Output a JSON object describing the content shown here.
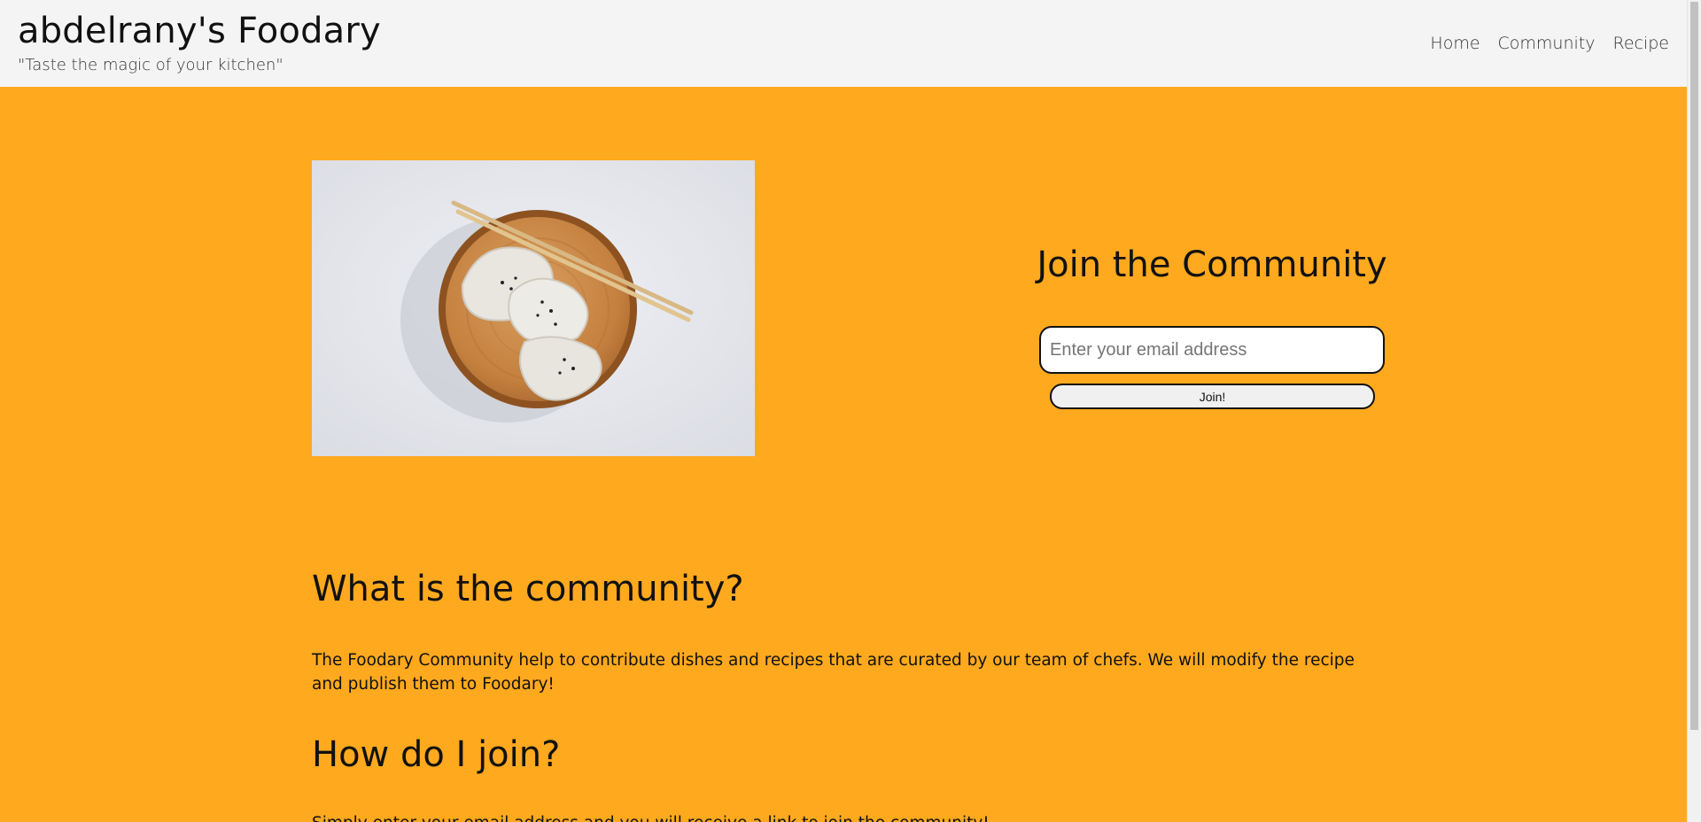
{
  "header": {
    "title": "abdelrany's Foodary",
    "tagline": "\"Taste the magic of your kitchen\"",
    "nav": [
      "Home",
      "Community",
      "Recipe"
    ]
  },
  "hero": {
    "image_icon": "dumplings-photo"
  },
  "join": {
    "heading": "Join the Community",
    "email_placeholder": "Enter your email address",
    "button_label": "Join!"
  },
  "sections": [
    {
      "heading": "What is the community?",
      "text": "The Foodary Community help to contribute dishes and recipes that are curated by our team of chefs. We will modify the recipe and publish them to Foodary!"
    },
    {
      "heading": "How do I join?",
      "text": "Simply enter your email address and you will receive a link to join the community!"
    }
  ],
  "colors": {
    "page_background": "#ffa91e",
    "header_background": "#f4f4f4"
  }
}
